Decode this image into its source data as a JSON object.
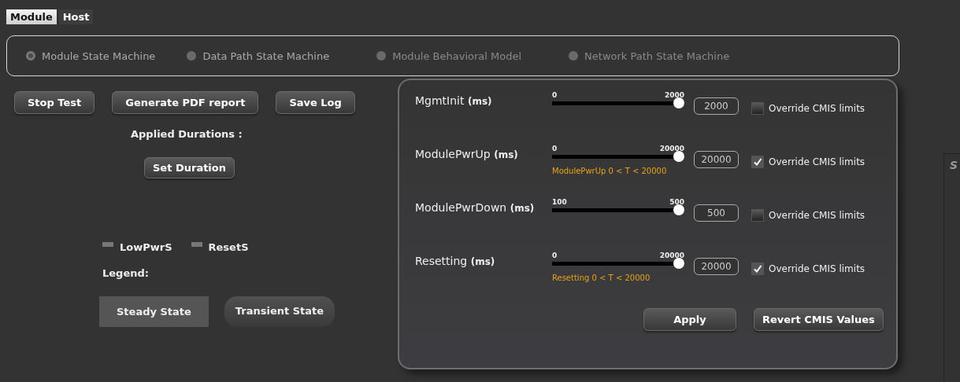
{
  "tabs": [
    {
      "label": "Module",
      "selected": true
    },
    {
      "label": "Host",
      "selected": false
    }
  ],
  "state_machines": [
    {
      "label": "Module State Machine",
      "selected": true,
      "disabled": false
    },
    {
      "label": "Data Path State Machine",
      "selected": false,
      "disabled": false
    },
    {
      "label": "Module Behavioral Model",
      "selected": false,
      "disabled": true
    },
    {
      "label": "Network Path State Machine",
      "selected": false,
      "disabled": true
    }
  ],
  "actions": [
    "Stop Test",
    "Generate PDF report",
    "Save Log"
  ],
  "applied_durations_label": "Applied Durations :",
  "set_duration_button": "Set Duration",
  "signals": [
    {
      "label": "LowPwrS",
      "on": false
    },
    {
      "label": "ResetS",
      "on": false
    }
  ],
  "legend_label": "Legend:",
  "legend": [
    {
      "label": "Steady State",
      "kind": "steady"
    },
    {
      "label": "Transient State",
      "kind": "transient"
    }
  ],
  "duration_dialog": {
    "rows": [
      {
        "label": "MgmtInit **(ms)**",
        "min": "0",
        "max": "2000",
        "level": 1,
        "value": "2000",
        "override_label": "Override CMIS limits",
        "override": false
      },
      {
        "label": "ModulePwrUp **(ms)**",
        "min": "0",
        "max": "20000",
        "level": 1,
        "value": "20000",
        "hint": "ModulePwrUp  0 < T < 20000",
        "override_label": "Override CMIS limits",
        "override": true
      },
      {
        "label": "ModulePwrDown **(ms)**",
        "min": "100",
        "max": "500",
        "level": 1,
        "value": "500",
        "override_label": "Override CMIS limits",
        "override": false
      },
      {
        "label": "Resetting **(ms)**",
        "min": "0",
        "max": "20000",
        "level": 1,
        "value": "20000",
        "hint": "Resetting  0 < T < 20000",
        "override_label": "Override CMIS limits",
        "override": true
      }
    ],
    "buttons": [
      "Apply",
      "Revert CMIS Values"
    ]
  },
  "side_panel": {
    "title": "S"
  }
}
